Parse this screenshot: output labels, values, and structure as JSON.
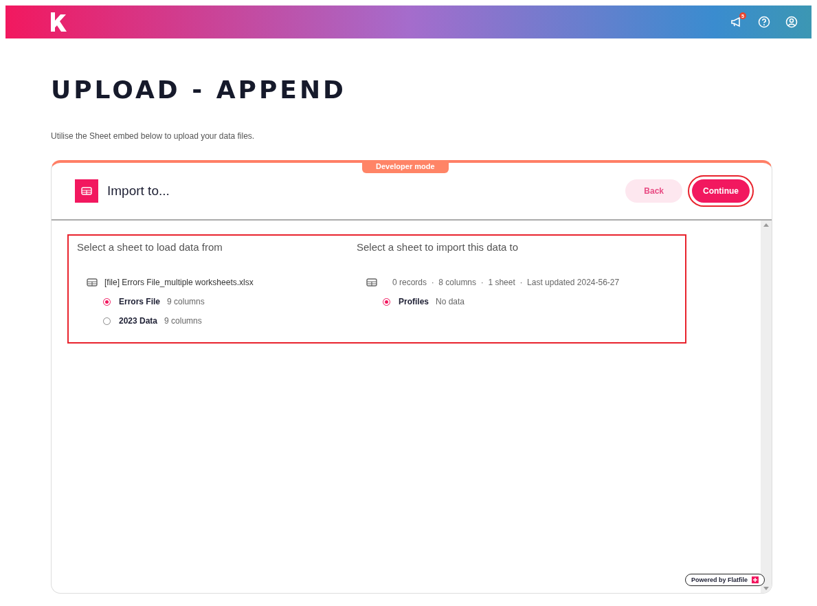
{
  "topbar": {
    "notification_count": "5"
  },
  "page": {
    "title": "UPLOAD - APPEND",
    "subtitle": "Utilise the Sheet embed below to upload your data files."
  },
  "embed": {
    "badge": "Developer mode",
    "title": "Import to...",
    "buttons": [
      {
        "label": "Back",
        "kind": "secondary",
        "highlighted": false
      },
      {
        "label": "Continue",
        "kind": "primary",
        "highlighted": true
      }
    ],
    "source": {
      "heading": "Select a sheet to load data from",
      "file": "[file] Errors File_multiple worksheets.xlsx",
      "sheets": [
        {
          "name": "Errors File",
          "info": "9 columns",
          "selected": true
        },
        {
          "name": "2023 Data",
          "info": "9 columns",
          "selected": false
        }
      ]
    },
    "target": {
      "heading": "Select a sheet to import this data to",
      "meta": "0 records  ·  8 columns  ·  1 sheet  ·  Last updated 2024-56-27",
      "sheets": [
        {
          "name": "Profiles",
          "info": "No data",
          "selected": true
        }
      ]
    },
    "selection_highlighted": true,
    "footer": "Powered by Flatfile"
  }
}
